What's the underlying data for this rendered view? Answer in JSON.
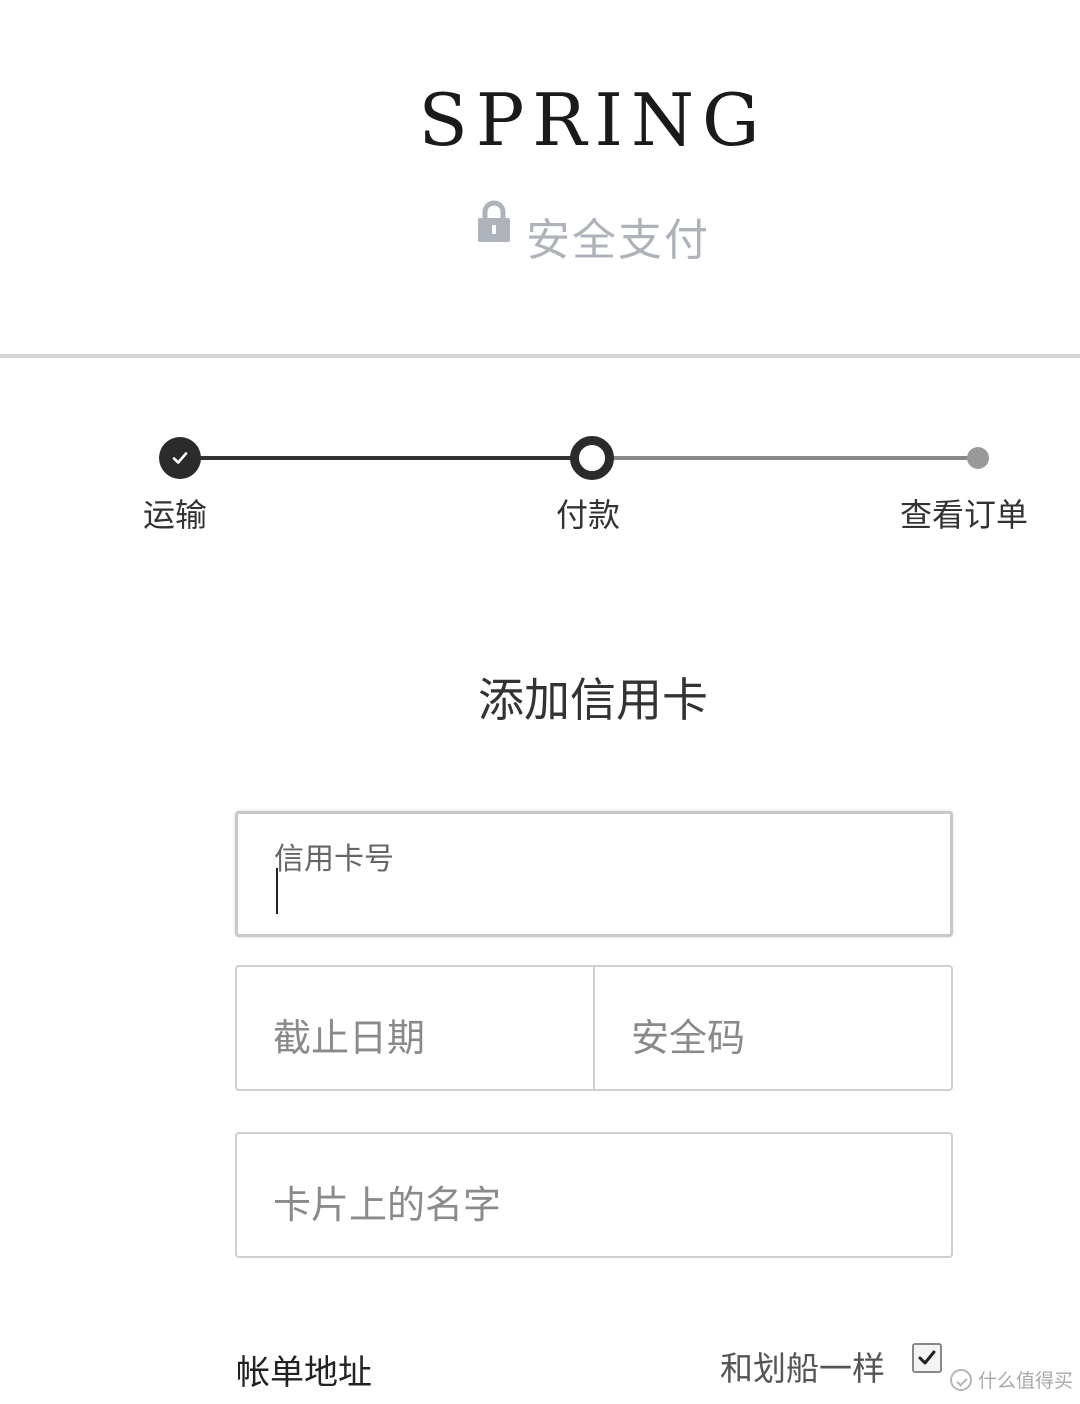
{
  "header": {
    "brand": "SPRING",
    "secure_label": "安全支付",
    "lock_icon": "lock-icon"
  },
  "stepper": {
    "steps": [
      {
        "label": "运输",
        "state": "completed"
      },
      {
        "label": "付款",
        "state": "current"
      },
      {
        "label": "查看订单",
        "state": "upcoming"
      }
    ]
  },
  "form": {
    "title": "添加信用卡",
    "card_number_label": "信用卡号",
    "card_number_value": "",
    "expiry_placeholder": "截止日期",
    "cvv_placeholder": "安全码",
    "name_placeholder": "卡片上的名字"
  },
  "billing": {
    "label": "帐单地址",
    "same_as_shipping_label": "和划船一样",
    "same_as_shipping_checked": true
  },
  "watermark": {
    "text": "什么值得买"
  },
  "colors": {
    "step_active": "#2b2b2b",
    "step_inactive": "#999999",
    "secure_text": "#aeb3bb",
    "divider": "#d5d5d5"
  }
}
